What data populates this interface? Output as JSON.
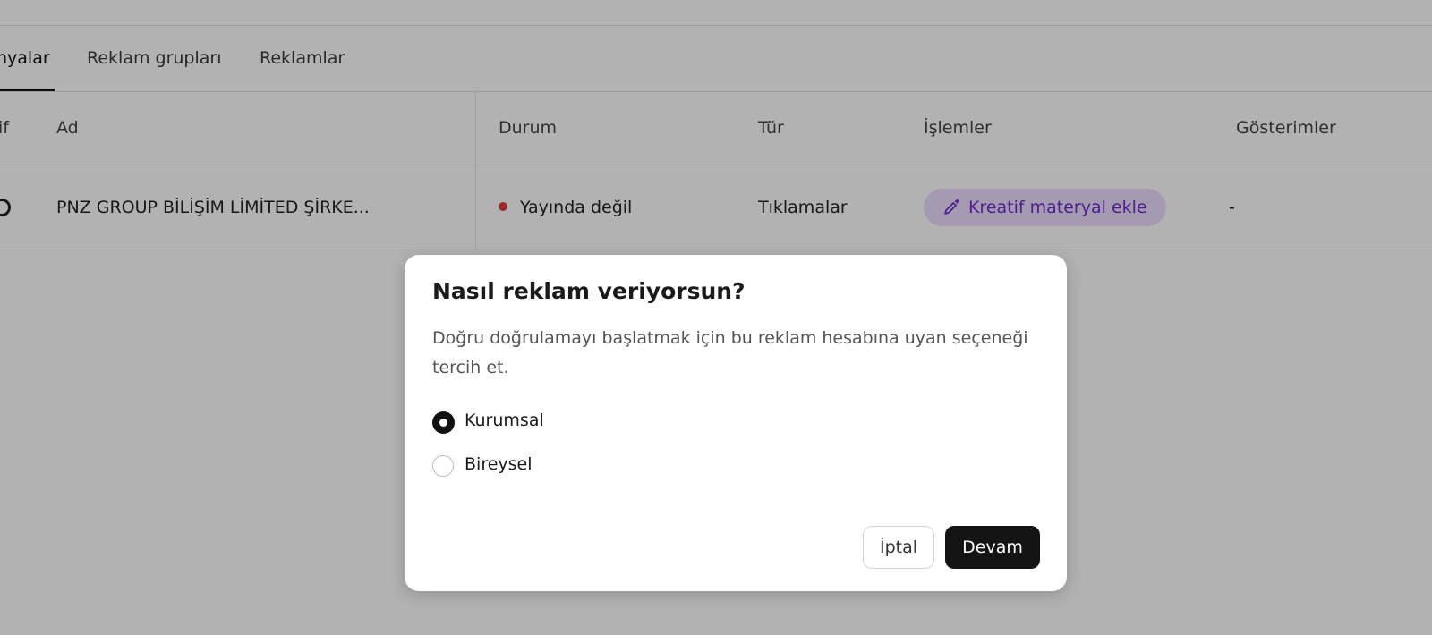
{
  "tabs": [
    {
      "label": "nyalar",
      "active": true
    },
    {
      "label": "Reklam grupları",
      "active": false
    },
    {
      "label": "Reklamlar",
      "active": false
    }
  ],
  "table": {
    "headers": {
      "active": "if",
      "name": "Ad",
      "status": "Durum",
      "type": "Tür",
      "actions": "İşlemler",
      "impressions": "Gösterimler"
    },
    "rows": [
      {
        "name": "PNZ GROUP BİLİŞİM LİMİTED ŞİRKE...",
        "status": "Yayında değil",
        "status_color": "#e03b3b",
        "type": "Tıklamalar",
        "action": "Kreatif materyal ekle",
        "action_icon": "pencil-sparkle-icon",
        "impressions": "-"
      }
    ]
  },
  "modal": {
    "title": "Nasıl reklam veriyorsun?",
    "description": "Doğru doğrulamayı başlatmak için bu reklam hesabına uyan seçeneği tercih et.",
    "options": [
      {
        "label": "Kurumsal",
        "selected": true
      },
      {
        "label": "Bireysel",
        "selected": false
      }
    ],
    "cancel_label": "İptal",
    "continue_label": "Devam"
  },
  "colors": {
    "accent_purple": "#6b2fc9",
    "chip_background": "#eedcff",
    "primary_button": "#141414",
    "status_offline": "#e03b3b"
  }
}
